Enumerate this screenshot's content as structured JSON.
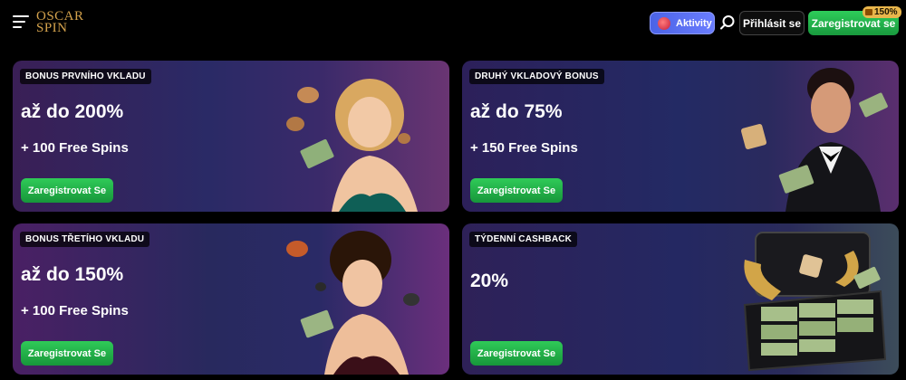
{
  "header": {
    "logo_line1": "OSCAR",
    "logo_line2": "SPIN",
    "aktivity_label": "Aktivity",
    "login_label": "Přihlásit se",
    "register_label": "Zaregistrovat se",
    "badge_text": "150%"
  },
  "cards": [
    {
      "tag": "BONUS PRVNÍHO VKLADU",
      "amount": "až do 200%",
      "spins": "+ 100 Free Spins",
      "button": "Zaregistrovat Se"
    },
    {
      "tag": "DRUHÝ VKLADOVÝ BONUS",
      "amount": "až do 75%",
      "spins": "+ 150 Free Spins",
      "button": "Zaregistrovat Se"
    },
    {
      "tag": "BONUS TŘETÍHO VKLADU",
      "amount": "až do 150%",
      "spins": "+ 100 Free Spins",
      "button": "Zaregistrovat Se"
    },
    {
      "tag": "TÝDENNÍ CASHBACK",
      "amount": "20%",
      "button": "Zaregistrovat Se"
    }
  ],
  "colors": {
    "accent_green": "#22b14c",
    "aktivity_blue": "#5a6ff0",
    "logo_gold": "#d4a24c",
    "badge_gold": "#e9b64b"
  },
  "icons": [
    "menu-icon",
    "aktivity-icon",
    "search-icon",
    "gift-icon"
  ]
}
